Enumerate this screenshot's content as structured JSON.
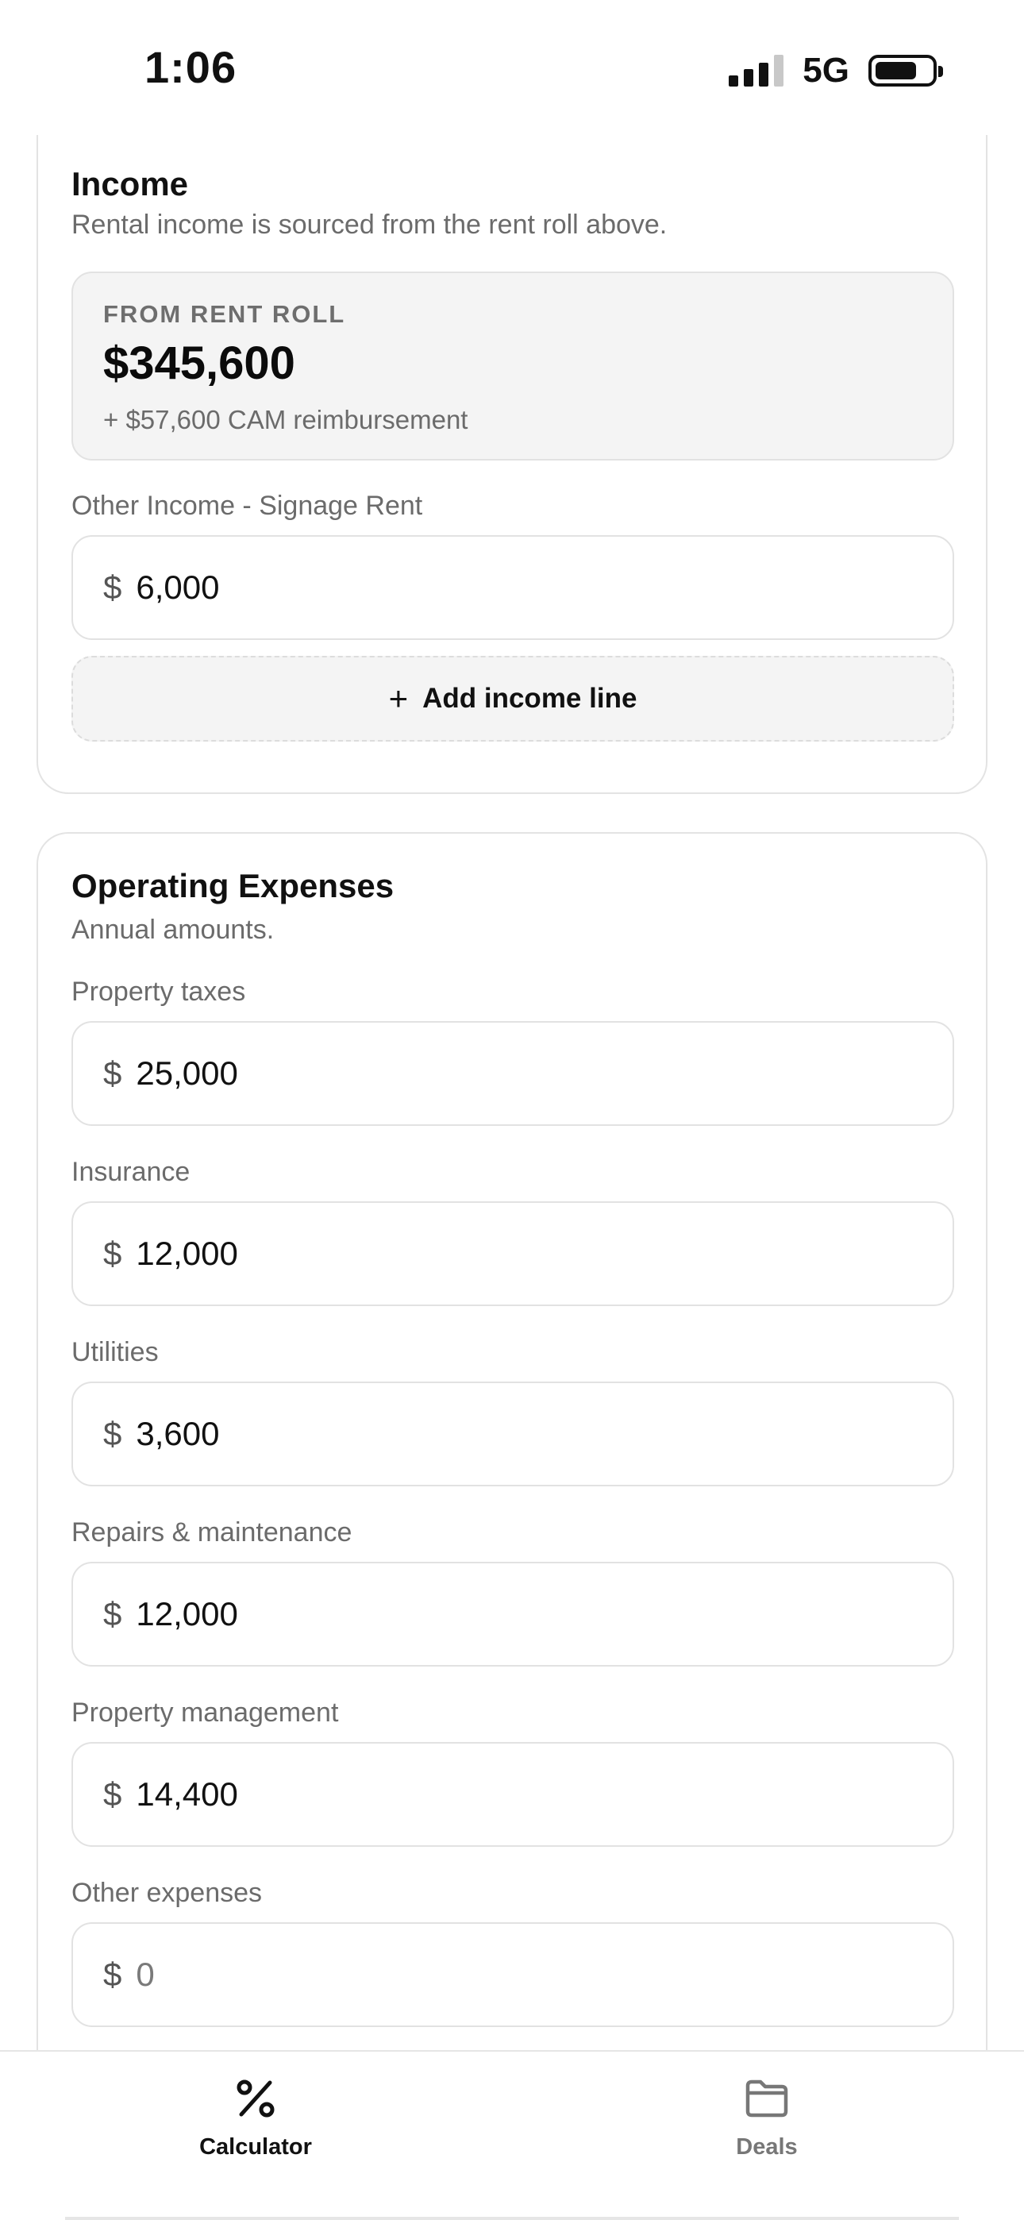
{
  "status_bar": {
    "time": "1:06",
    "network": "5G",
    "battery_level": 0.75
  },
  "income": {
    "title": "Income",
    "subtitle": "Rental income is sourced from the rent roll above.",
    "rent_roll": {
      "label": "FROM RENT ROLL",
      "value": "$345,600",
      "note": "+ $57,600 CAM reimbursement"
    },
    "other_income": {
      "label": "Other Income - Signage Rent",
      "currency": "$",
      "value": "6,000"
    },
    "add_line": {
      "plus": "+",
      "label": "Add income line"
    }
  },
  "operating_expenses": {
    "title": "Operating Expenses",
    "subtitle": "Annual amounts.",
    "fields": [
      {
        "label": "Property taxes",
        "currency": "$",
        "value": "25,000"
      },
      {
        "label": "Insurance",
        "currency": "$",
        "value": "12,000"
      },
      {
        "label": "Utilities",
        "currency": "$",
        "value": "3,600"
      },
      {
        "label": "Repairs & maintenance",
        "currency": "$",
        "value": "12,000"
      },
      {
        "label": "Property management",
        "currency": "$",
        "value": "14,400"
      },
      {
        "label": "Other expenses",
        "currency": "$",
        "value": "0"
      }
    ]
  },
  "tab_bar": {
    "tabs": [
      {
        "label": "Calculator",
        "icon": "percent-icon",
        "active": true
      },
      {
        "label": "Deals",
        "icon": "folder-icon",
        "active": false
      }
    ],
    "active_color": "#111111",
    "inactive_color": "#777777"
  }
}
